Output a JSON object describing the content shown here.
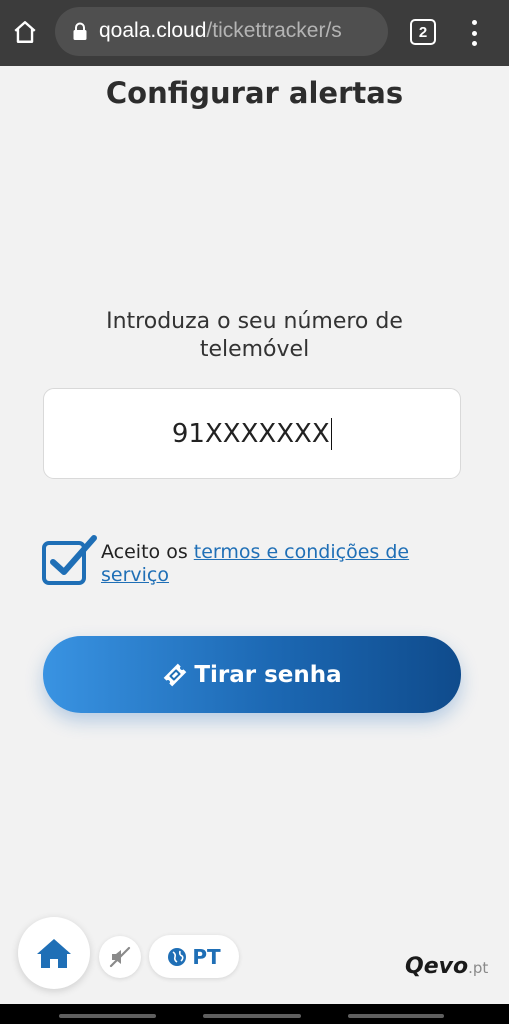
{
  "browser": {
    "url_domain": "qoala.cloud",
    "url_path": "/tickettracker/s",
    "tab_count": "2",
    "icons": [
      "home-icon",
      "lock-icon",
      "more-vert-icon"
    ]
  },
  "page": {
    "title": "Configurar alertas",
    "prompt": "Introduza o seu número de telemóvel",
    "phone_value": "91XXXXXXX",
    "terms_prefix": "Aceito os ",
    "terms_link": "termos e condições de serviço",
    "terms_checked": true,
    "submit_label": "Tirar senha"
  },
  "footer": {
    "language": "PT",
    "brand_name": "Qevo",
    "brand_tld": ".pt"
  },
  "colors": {
    "accent": "#1f6fb6",
    "button_start": "#3993e2",
    "button_end": "#0f4b8c",
    "background": "#f2f2f2"
  }
}
